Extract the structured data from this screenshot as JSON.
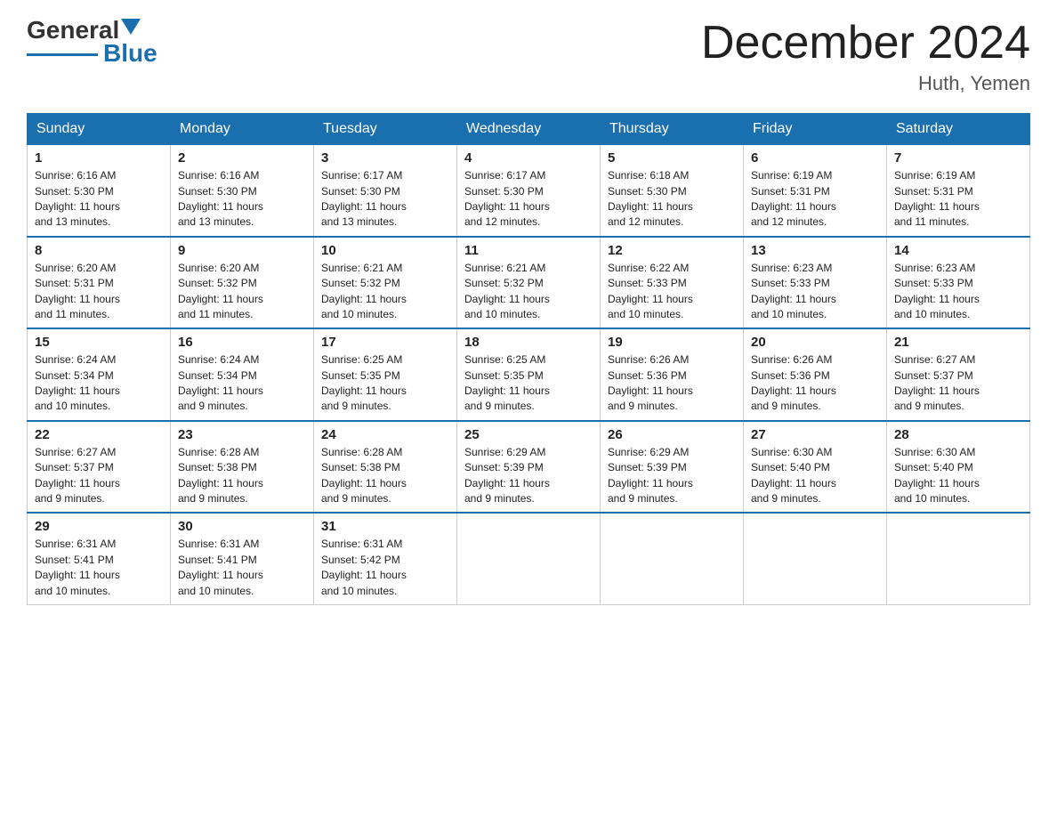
{
  "logo": {
    "general": "General",
    "blue": "Blue"
  },
  "header": {
    "title": "December 2024",
    "subtitle": "Huth, Yemen"
  },
  "calendar": {
    "days": [
      "Sunday",
      "Monday",
      "Tuesday",
      "Wednesday",
      "Thursday",
      "Friday",
      "Saturday"
    ],
    "weeks": [
      [
        {
          "num": "1",
          "sunrise": "6:16 AM",
          "sunset": "5:30 PM",
          "daylight": "11 hours and 13 minutes."
        },
        {
          "num": "2",
          "sunrise": "6:16 AM",
          "sunset": "5:30 PM",
          "daylight": "11 hours and 13 minutes."
        },
        {
          "num": "3",
          "sunrise": "6:17 AM",
          "sunset": "5:30 PM",
          "daylight": "11 hours and 13 minutes."
        },
        {
          "num": "4",
          "sunrise": "6:17 AM",
          "sunset": "5:30 PM",
          "daylight": "11 hours and 12 minutes."
        },
        {
          "num": "5",
          "sunrise": "6:18 AM",
          "sunset": "5:30 PM",
          "daylight": "11 hours and 12 minutes."
        },
        {
          "num": "6",
          "sunrise": "6:19 AM",
          "sunset": "5:31 PM",
          "daylight": "11 hours and 12 minutes."
        },
        {
          "num": "7",
          "sunrise": "6:19 AM",
          "sunset": "5:31 PM",
          "daylight": "11 hours and 11 minutes."
        }
      ],
      [
        {
          "num": "8",
          "sunrise": "6:20 AM",
          "sunset": "5:31 PM",
          "daylight": "11 hours and 11 minutes."
        },
        {
          "num": "9",
          "sunrise": "6:20 AM",
          "sunset": "5:32 PM",
          "daylight": "11 hours and 11 minutes."
        },
        {
          "num": "10",
          "sunrise": "6:21 AM",
          "sunset": "5:32 PM",
          "daylight": "11 hours and 10 minutes."
        },
        {
          "num": "11",
          "sunrise": "6:21 AM",
          "sunset": "5:32 PM",
          "daylight": "11 hours and 10 minutes."
        },
        {
          "num": "12",
          "sunrise": "6:22 AM",
          "sunset": "5:33 PM",
          "daylight": "11 hours and 10 minutes."
        },
        {
          "num": "13",
          "sunrise": "6:23 AM",
          "sunset": "5:33 PM",
          "daylight": "11 hours and 10 minutes."
        },
        {
          "num": "14",
          "sunrise": "6:23 AM",
          "sunset": "5:33 PM",
          "daylight": "11 hours and 10 minutes."
        }
      ],
      [
        {
          "num": "15",
          "sunrise": "6:24 AM",
          "sunset": "5:34 PM",
          "daylight": "11 hours and 10 minutes."
        },
        {
          "num": "16",
          "sunrise": "6:24 AM",
          "sunset": "5:34 PM",
          "daylight": "11 hours and 9 minutes."
        },
        {
          "num": "17",
          "sunrise": "6:25 AM",
          "sunset": "5:35 PM",
          "daylight": "11 hours and 9 minutes."
        },
        {
          "num": "18",
          "sunrise": "6:25 AM",
          "sunset": "5:35 PM",
          "daylight": "11 hours and 9 minutes."
        },
        {
          "num": "19",
          "sunrise": "6:26 AM",
          "sunset": "5:36 PM",
          "daylight": "11 hours and 9 minutes."
        },
        {
          "num": "20",
          "sunrise": "6:26 AM",
          "sunset": "5:36 PM",
          "daylight": "11 hours and 9 minutes."
        },
        {
          "num": "21",
          "sunrise": "6:27 AM",
          "sunset": "5:37 PM",
          "daylight": "11 hours and 9 minutes."
        }
      ],
      [
        {
          "num": "22",
          "sunrise": "6:27 AM",
          "sunset": "5:37 PM",
          "daylight": "11 hours and 9 minutes."
        },
        {
          "num": "23",
          "sunrise": "6:28 AM",
          "sunset": "5:38 PM",
          "daylight": "11 hours and 9 minutes."
        },
        {
          "num": "24",
          "sunrise": "6:28 AM",
          "sunset": "5:38 PM",
          "daylight": "11 hours and 9 minutes."
        },
        {
          "num": "25",
          "sunrise": "6:29 AM",
          "sunset": "5:39 PM",
          "daylight": "11 hours and 9 minutes."
        },
        {
          "num": "26",
          "sunrise": "6:29 AM",
          "sunset": "5:39 PM",
          "daylight": "11 hours and 9 minutes."
        },
        {
          "num": "27",
          "sunrise": "6:30 AM",
          "sunset": "5:40 PM",
          "daylight": "11 hours and 9 minutes."
        },
        {
          "num": "28",
          "sunrise": "6:30 AM",
          "sunset": "5:40 PM",
          "daylight": "11 hours and 10 minutes."
        }
      ],
      [
        {
          "num": "29",
          "sunrise": "6:31 AM",
          "sunset": "5:41 PM",
          "daylight": "11 hours and 10 minutes."
        },
        {
          "num": "30",
          "sunrise": "6:31 AM",
          "sunset": "5:41 PM",
          "daylight": "11 hours and 10 minutes."
        },
        {
          "num": "31",
          "sunrise": "6:31 AM",
          "sunset": "5:42 PM",
          "daylight": "11 hours and 10 minutes."
        },
        null,
        null,
        null,
        null
      ]
    ],
    "labels": {
      "sunrise": "Sunrise:",
      "sunset": "Sunset:",
      "daylight": "Daylight:"
    }
  }
}
